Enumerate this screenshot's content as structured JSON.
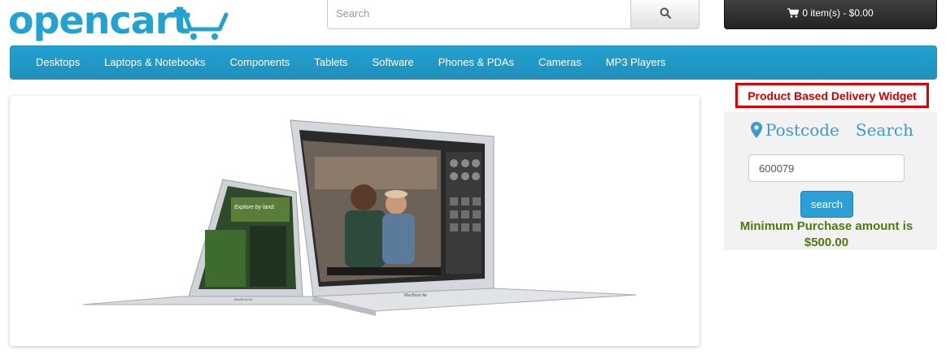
{
  "header": {
    "logo_text": "opencart",
    "search": {
      "placeholder": "Search",
      "value": ""
    },
    "cart": {
      "label": "0 item(s) - $0.00"
    }
  },
  "menu": {
    "items": [
      {
        "label": "Desktops"
      },
      {
        "label": "Laptops & Notebooks"
      },
      {
        "label": "Components"
      },
      {
        "label": "Tablets"
      },
      {
        "label": "Software"
      },
      {
        "label": "Phones & PDAs"
      },
      {
        "label": "Cameras"
      },
      {
        "label": "MP3 Players"
      }
    ]
  },
  "slideshow": {
    "screen_text": "Explore by land.",
    "brand_left": "MacBook Air",
    "brand_right": "MacBook Air"
  },
  "widget": {
    "label": "Product Based Delivery Widget",
    "title_word1": "Postcode",
    "title_word2": "Search",
    "postcode_value": "600079",
    "search_button": "search",
    "message": "Minimum Purchase amount is $500.00"
  },
  "colors": {
    "brand_blue": "#23a1d1",
    "widget_red": "#e00000",
    "message_green": "#4c7a12"
  },
  "icons": [
    "search-icon",
    "cart-icon",
    "map-pin-icon"
  ]
}
